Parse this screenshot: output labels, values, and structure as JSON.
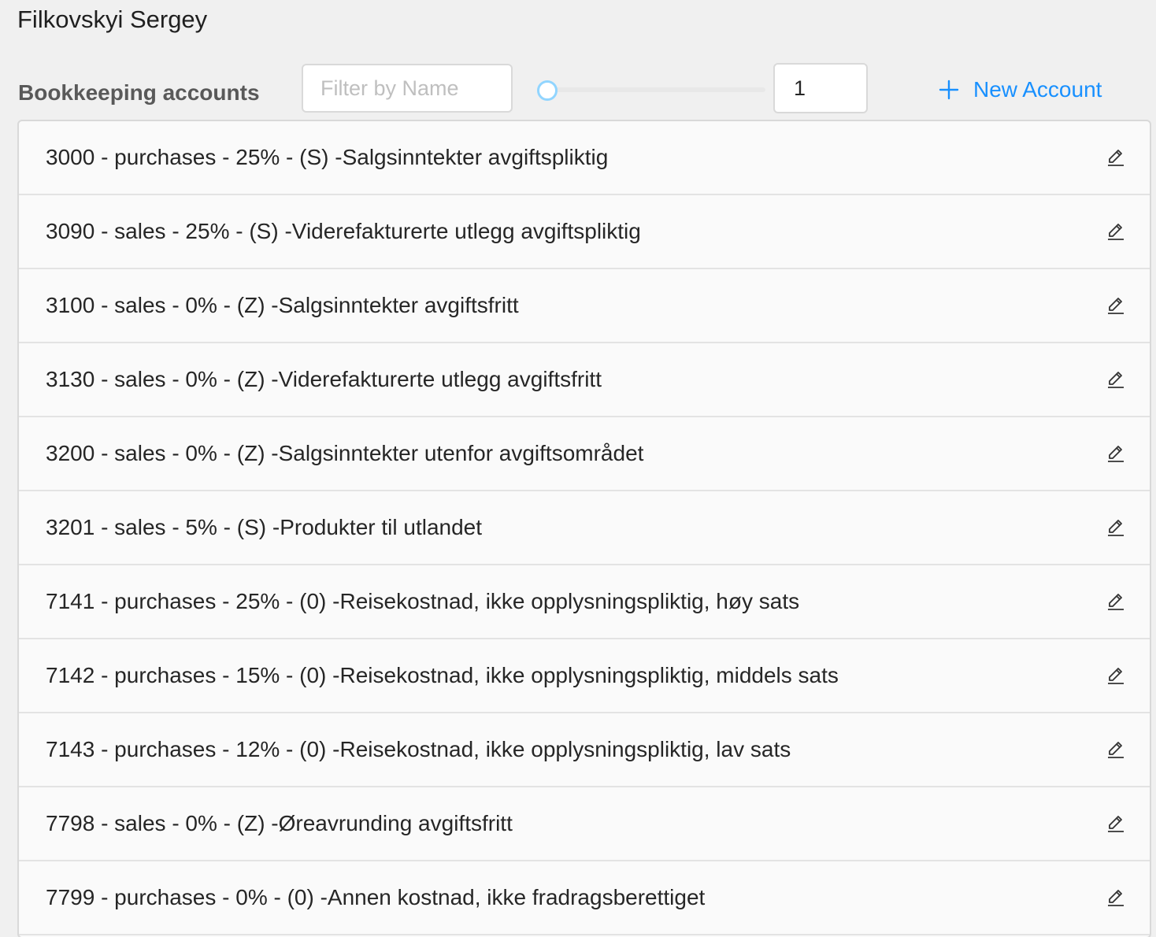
{
  "header": {
    "user_name": "Filkovskyi Sergey"
  },
  "toolbar": {
    "section_title": "Bookkeeping accounts",
    "filter_placeholder": "Filter by Name",
    "filter_value": "",
    "slider_value": 1,
    "number_value": "1",
    "new_account_label": "New Account",
    "accent_color": "#1890ff"
  },
  "accounts": [
    {
      "label": "3000 - purchases - 25% - (S) -Salgsinntekter avgiftspliktig",
      "icon": "edit-icon"
    },
    {
      "label": "3090 - sales - 25% - (S) -Viderefakturerte utlegg avgiftspliktig",
      "icon": "edit-icon"
    },
    {
      "label": "3100 - sales - 0% - (Z) -Salgsinntekter avgiftsfritt",
      "icon": "edit-icon"
    },
    {
      "label": "3130 - sales - 0% - (Z) -Viderefakturerte utlegg avgiftsfritt",
      "icon": "edit-icon"
    },
    {
      "label": "3200 - sales - 0% - (Z) -Salgsinntekter utenfor avgiftsområdet",
      "icon": "edit-icon"
    },
    {
      "label": "3201 - sales - 5% - (S) -Produkter til utlandet",
      "icon": "edit-icon"
    },
    {
      "label": "7141 - purchases - 25% - (0) -Reisekostnad, ikke opplysningspliktig, høy sats",
      "icon": "edit-icon"
    },
    {
      "label": "7142 - purchases - 15% - (0) -Reisekostnad, ikke opplysningspliktig, middels sats",
      "icon": "edit-icon"
    },
    {
      "label": "7143 - purchases - 12% - (0) -Reisekostnad, ikke opplysningspliktig, lav sats",
      "icon": "edit-icon"
    },
    {
      "label": "7798 - sales - 0% - (Z) -Øreavrunding avgiftsfritt",
      "icon": "edit-icon"
    },
    {
      "label": "7799 - purchases - 0% - (0) -Annen kostnad, ikke fradragsberettiget",
      "icon": "edit-icon"
    }
  ]
}
